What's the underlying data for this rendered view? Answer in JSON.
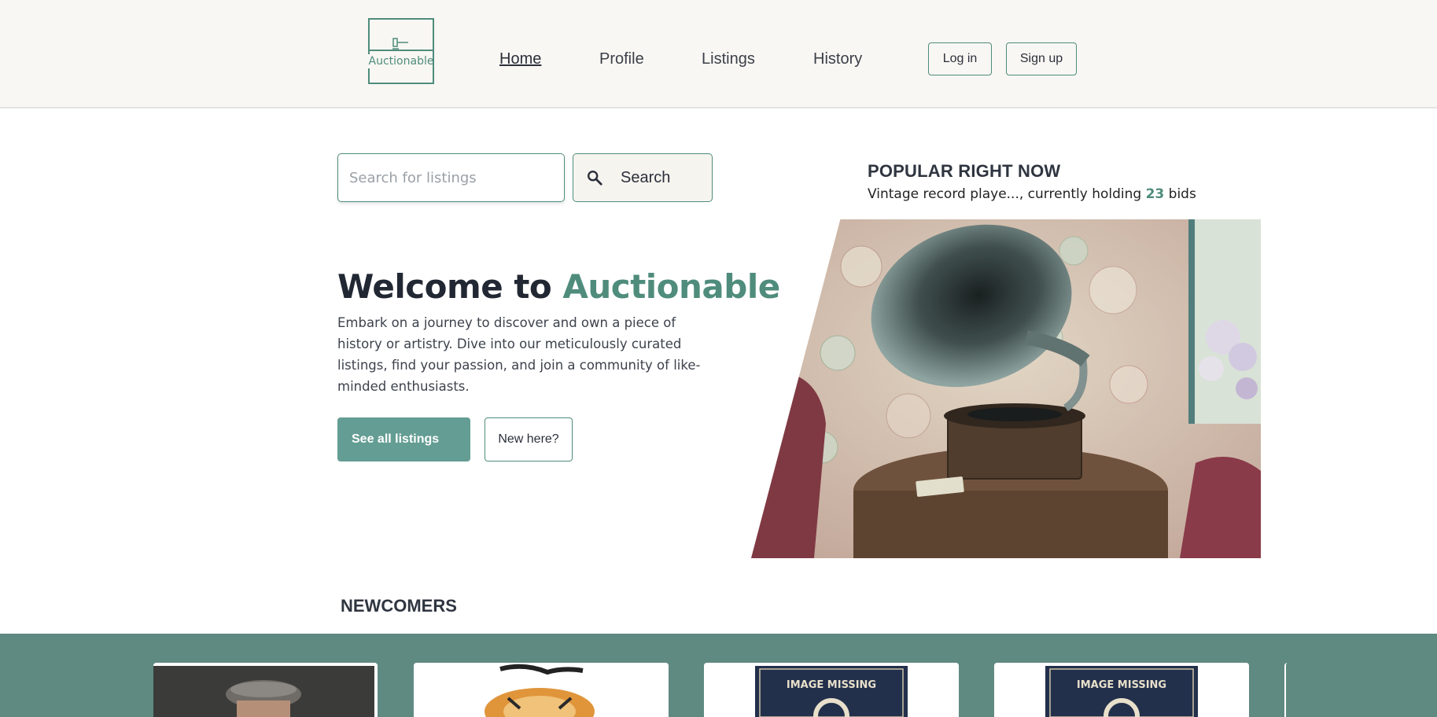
{
  "header": {
    "logo_text": "Auctionable",
    "nav": [
      {
        "label": "Home",
        "active": true
      },
      {
        "label": "Profile",
        "active": false
      },
      {
        "label": "Listings",
        "active": false
      },
      {
        "label": "History",
        "active": false
      }
    ],
    "login_label": "Log in",
    "signup_label": "Sign up"
  },
  "search": {
    "placeholder": "Search for listings",
    "value": "",
    "button_label": "Search",
    "icon": "search-icon"
  },
  "hero": {
    "title_prefix": "Welcome to ",
    "title_brand": "Auctionable",
    "description": "Embark on a journey to discover and own a piece of history or artistry. Dive into our meticulously curated listings, find your passion, and join a community of like-minded enthusiasts.",
    "primary_button": "See all listings",
    "secondary_button": "New here?"
  },
  "popular": {
    "heading": "POPULAR RIGHT NOW",
    "item_name": "Vintage record playe...",
    "text_mid": ", currently holding ",
    "bid_count": "23",
    "text_end": " bids"
  },
  "newcomers": {
    "heading": "NEWCOMERS",
    "cards": [
      {
        "image": "man-in-flat-cap"
      },
      {
        "image": "tiger"
      },
      {
        "image_label": "IMAGE MISSING"
      },
      {
        "image_label": "IMAGE MISSING"
      }
    ]
  },
  "colors": {
    "accent": "#4f8c7c",
    "primary_button": "#649d93",
    "header_bg": "#f9f7f3",
    "band_bg": "#5f8a82"
  }
}
